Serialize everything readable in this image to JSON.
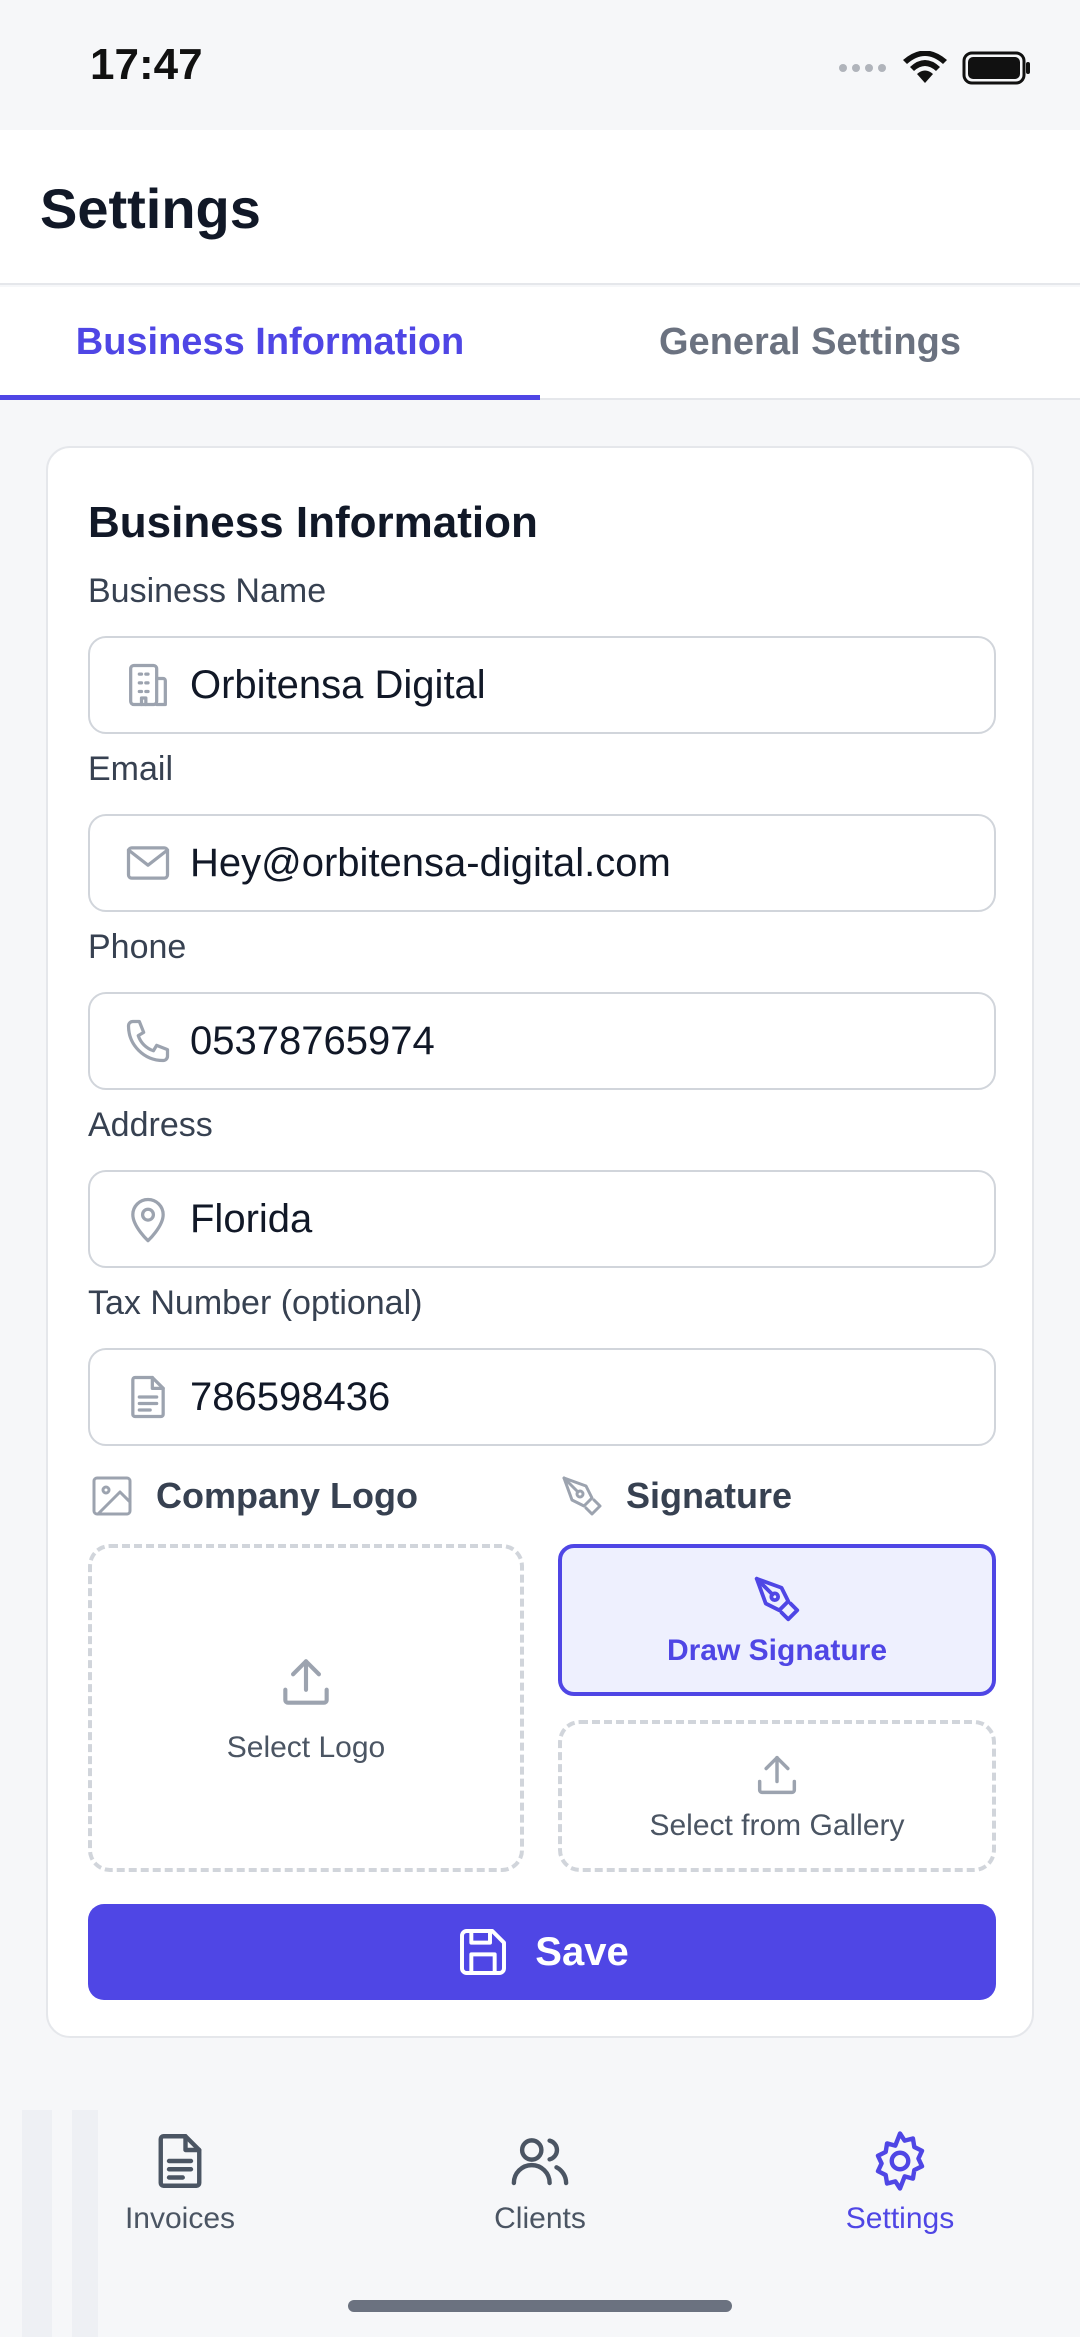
{
  "status_bar": {
    "time": "17:47"
  },
  "header": {
    "title": "Settings"
  },
  "tabs": [
    {
      "label": "Business Information",
      "active": true
    },
    {
      "label": "General Settings",
      "active": false
    }
  ],
  "card": {
    "section_title": "Business Information",
    "fields": {
      "business_name": {
        "label": "Business Name",
        "value": "Orbitensa Digital",
        "icon": "building-icon"
      },
      "email": {
        "label": "Email",
        "value": "Hey@orbitensa-digital.com",
        "icon": "mail-icon"
      },
      "phone": {
        "label": "Phone",
        "value": "05378765974",
        "icon": "phone-icon"
      },
      "address": {
        "label": "Address",
        "value": "Florida",
        "icon": "map-pin-icon"
      },
      "tax_number": {
        "label": "Tax Number (optional)",
        "value": "786598436",
        "icon": "document-icon"
      }
    },
    "company_logo": {
      "label": "Company Logo",
      "select_label": "Select Logo"
    },
    "signature": {
      "label": "Signature",
      "draw_label": "Draw Signature",
      "gallery_label": "Select from Gallery"
    },
    "save_label": "Save"
  },
  "bottom_nav": [
    {
      "label": "Invoices",
      "icon": "document-icon",
      "active": false
    },
    {
      "label": "Clients",
      "icon": "users-icon",
      "active": false
    },
    {
      "label": "Settings",
      "icon": "gear-icon",
      "active": true
    }
  ],
  "colors": {
    "accent": "#4f46e5",
    "accent_light": "#eef0fe",
    "border": "#d1d5db"
  }
}
